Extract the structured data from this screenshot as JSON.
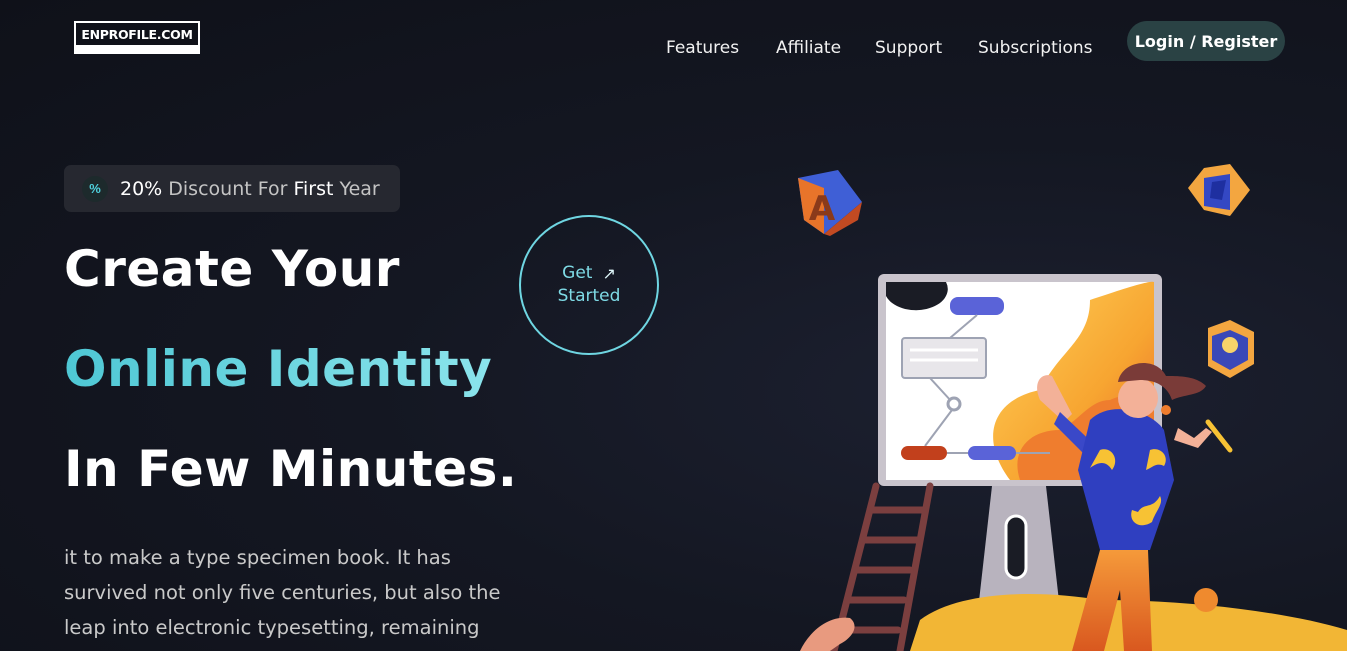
{
  "logo": {
    "text": "ENPROFILE.COM"
  },
  "nav": {
    "items": [
      "Features",
      "Affiliate",
      "Support",
      "Subscriptions"
    ]
  },
  "auth": {
    "label": "Login / Register"
  },
  "badge": {
    "icon": "percent-icon",
    "pct": "20%",
    "pre": " Discount For ",
    "first": "First",
    "post": " Year"
  },
  "hero": {
    "line1": "Create Your",
    "line2": "Online Identity",
    "line3": "In Few Minutes.",
    "description": "it to make a type specimen book. It has survived not only five centuries, but also the leap into electronic typesetting, remaining"
  },
  "cta": {
    "line1": "Get",
    "line2": "Started",
    "icon": "arrow-up-right-icon"
  },
  "colors": {
    "accent": "#4ec7d4",
    "background": "#141722",
    "login_bg": "#2a4244"
  }
}
